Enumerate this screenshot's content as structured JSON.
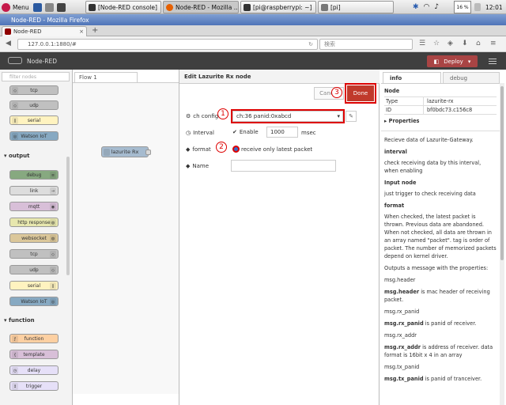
{
  "taskbar": {
    "menu_label": "Menu",
    "windows": [
      "[Node-RED console]",
      "Node-RED - Mozilla ...",
      "[pi@raspberrypi: ~]",
      "[pi]"
    ],
    "battery": "16 %",
    "clock": "12:01"
  },
  "browser": {
    "window_title": "Node-RED - Mozilla Firefox",
    "tab_title": "Node-RED",
    "url": "127.0.0.1:1880/#",
    "search_placeholder": "検索"
  },
  "nodered": {
    "app_title": "Node-RED",
    "deploy_label": "Deploy"
  },
  "palette": {
    "filter_placeholder": "filter nodes",
    "top_nodes": [
      "tcp",
      "udp",
      "serial",
      "Watson IoT"
    ],
    "categories": {
      "output": "output",
      "function": "function"
    },
    "output_nodes": [
      "debug",
      "link",
      "mqtt",
      "http response",
      "websocket",
      "tcp",
      "udp",
      "serial",
      "Watson IoT"
    ],
    "function_nodes": [
      "function",
      "template",
      "delay",
      "trigger"
    ]
  },
  "workspace": {
    "tab_label": "Flow 1",
    "node_label": "lazurite Rx"
  },
  "editor": {
    "title": "Edit Lazurite Rx node",
    "cancel_label": "Cancel",
    "done_label": "Done",
    "ch_config_label": "ch config",
    "ch_config_value": "ch:36 panid:0xabcd",
    "interval_label": "Interval",
    "enable_label": "Enable",
    "interval_value": "1000",
    "interval_unit": "msec",
    "format_label": "format",
    "format_option": "receive only latest packet",
    "name_label": "Name",
    "name_value": "",
    "callout_1": "1",
    "callout_2": "2",
    "callout_3": "3"
  },
  "sidebar": {
    "tab_info": "info",
    "tab_debug": "debug",
    "node_heading": "Node",
    "type_key": "Type",
    "type_value": "lazurite-rx",
    "id_key": "ID",
    "id_value": "bf0bdc73.c156c8",
    "properties": "Properties",
    "desc": [
      "Recieve data of Lazurite-Gateway.",
      "interval",
      "check receiving data by this interval, when enabling",
      "Input node",
      "just trigger to check receiving data",
      "format",
      "When checked, the latest packet is thrown. Previous data are abandoned. When not checked, all data are thrown in an array named \"packet\". tag is order of packet. The number of memorized packets depend on kernel driver.",
      "Outputs a message with the properties:",
      "msg.header",
      "msg.header",
      " is mac header of receiving packet.",
      "msg.rx_panid",
      "msg.rx_panid",
      " is panid of receiver.",
      "msg.rx_addr",
      "msg.rx_addr",
      " is address of receiver. data format is 16bit x 4 in an array",
      "msg.tx_panid",
      "msg.tx_panid",
      " is panid of tranceiver."
    ]
  },
  "colors": {
    "deploy": "#a94444",
    "header": "#3f3f3f",
    "lazurite_node": "#a6bbcf",
    "callout": "#dd0000",
    "done_button": "#c0392b"
  }
}
